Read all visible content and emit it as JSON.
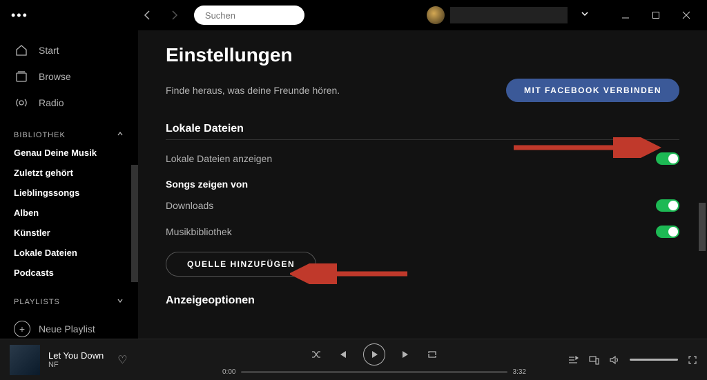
{
  "search": {
    "placeholder": "Suchen"
  },
  "nav": {
    "start": "Start",
    "browse": "Browse",
    "radio": "Radio"
  },
  "library": {
    "header": "BIBLIOTHEK",
    "items": [
      "Genau Deine Musik",
      "Zuletzt gehört",
      "Lieblingssongs",
      "Alben",
      "Künstler",
      "Lokale Dateien",
      "Podcasts"
    ]
  },
  "playlists": {
    "header": "PLAYLISTS",
    "new": "Neue Playlist"
  },
  "settings": {
    "title": "Einstellungen",
    "facebook_desc": "Finde heraus, was deine Freunde hören.",
    "facebook_btn": "MIT FACEBOOK VERBINDEN",
    "local_files_header": "Lokale Dateien",
    "show_local_files": "Lokale Dateien anzeigen",
    "songs_from_header": "Songs zeigen von",
    "downloads": "Downloads",
    "music_library": "Musikbibliothek",
    "add_source_btn": "QUELLE HINZUFÜGEN",
    "display_options_header": "Anzeigeoptionen"
  },
  "player": {
    "track": "Let You Down",
    "artist": "NF",
    "elapsed": "0:00",
    "duration": "3:32"
  },
  "colors": {
    "accent": "#1db954",
    "facebook": "#3b5998"
  }
}
